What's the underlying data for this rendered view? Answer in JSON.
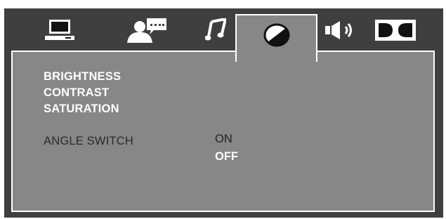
{
  "tabs": [
    {
      "icon": "monitor-icon",
      "active": false
    },
    {
      "icon": "person-speech-icon",
      "active": false
    },
    {
      "icon": "music-note-icon",
      "active": false
    },
    {
      "icon": "video-adjust-icon",
      "active": true
    },
    {
      "icon": "speaker-icon",
      "active": false
    },
    {
      "icon": "dolby-icon",
      "active": false
    }
  ],
  "menu": {
    "brightness": "BRIGHTNESS",
    "contrast": "CONTRAST",
    "saturation": "SATURATION",
    "angle_switch": "ANGLE SWITCH"
  },
  "angle_switch_options": {
    "on": "ON",
    "off": "OFF",
    "selected": "OFF"
  },
  "colors": {
    "background": "#3f3f40",
    "panel": "#878788",
    "highlight": "#ffffff",
    "dim_text": "#2a2a2a"
  }
}
